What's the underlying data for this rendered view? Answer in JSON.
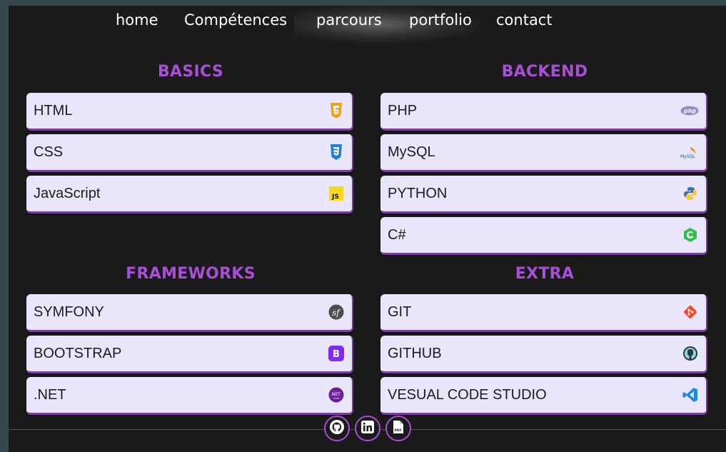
{
  "nav": {
    "items": [
      {
        "label": "home"
      },
      {
        "label": "Compétences"
      },
      {
        "label": "parcours"
      },
      {
        "label": "portfolio"
      },
      {
        "label": "contact"
      }
    ]
  },
  "sections": {
    "basics": {
      "title": "BASICS",
      "items": [
        {
          "label": "HTML",
          "icon": "html5-icon"
        },
        {
          "label": "CSS",
          "icon": "css3-icon"
        },
        {
          "label": "JavaScript",
          "icon": "javascript-icon"
        }
      ]
    },
    "backend": {
      "title": "BACKEND",
      "items": [
        {
          "label": "PHP",
          "icon": "php-icon"
        },
        {
          "label": "MySQL",
          "icon": "mysql-icon"
        },
        {
          "label": "PYTHON",
          "icon": "python-icon"
        },
        {
          "label": "C#",
          "icon": "csharp-icon"
        }
      ]
    },
    "frameworks": {
      "title": "FRAMEWORKS",
      "items": [
        {
          "label": "SYMFONY",
          "icon": "symfony-icon"
        },
        {
          "label": "BOOTSTRAP",
          "icon": "bootstrap-icon"
        },
        {
          "label": ".NET",
          "icon": "dotnet-icon"
        }
      ]
    },
    "extra": {
      "title": "EXTRA",
      "items": [
        {
          "label": "GIT",
          "icon": "git-icon"
        },
        {
          "label": "GITHUB",
          "icon": "github-octocat-icon"
        },
        {
          "label": "VESUAL CODE STUDIO",
          "icon": "vscode-icon"
        }
      ]
    }
  },
  "footer": {
    "social": [
      {
        "icon": "github-icon"
      },
      {
        "icon": "linkedin-icon"
      },
      {
        "icon": "pdf-icon"
      }
    ]
  },
  "colors": {
    "accent": "#a94fd6",
    "card": "#e9e6fb",
    "background": "#1b1b1b"
  }
}
